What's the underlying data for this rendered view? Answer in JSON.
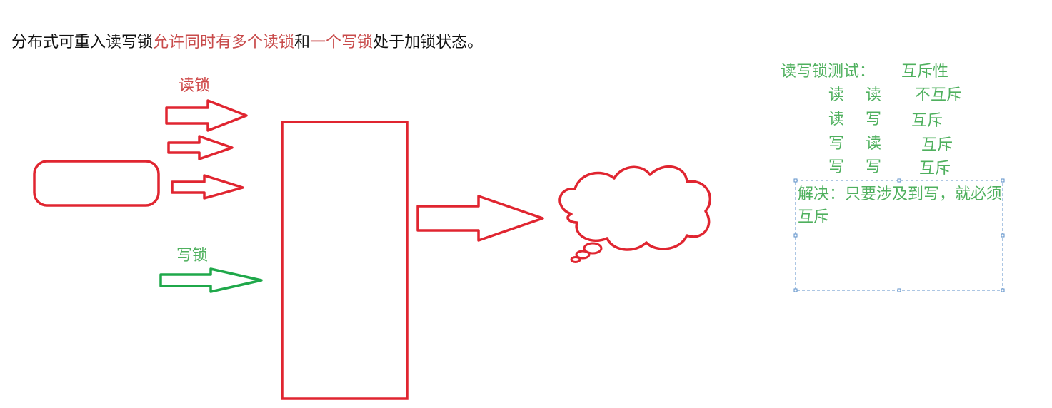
{
  "title": {
    "part1": "分布式可重入读写锁",
    "part2": "允许同时有多个读锁",
    "part3": "和",
    "part4": "一个写锁",
    "part5": "处于加锁状态。"
  },
  "colors": {
    "red": "#e02530",
    "green": "#1fa84a",
    "note_green": "#4fb05e",
    "highlight_red": "#c84b4b",
    "selection_blue": "#5b8fc9"
  },
  "labels": {
    "read_lock": "读锁",
    "write_lock": "写锁"
  },
  "test": {
    "heading": "读写锁测试：",
    "heading_value": "互斥性",
    "rows": [
      {
        "a": "读",
        "b": "读",
        "result": "不互斥"
      },
      {
        "a": "读",
        "b": "写",
        "result": "互斥"
      },
      {
        "a": "写",
        "b": "读",
        "result": "互斥"
      },
      {
        "a": "写",
        "b": "写",
        "result": "互斥"
      }
    ]
  },
  "note": {
    "text": "解决：只要涉及到写，就必须互斥"
  },
  "shapes": {
    "client": "rounded-rectangle",
    "lock_store": "rectangle",
    "outcome": "thought-cloud"
  }
}
